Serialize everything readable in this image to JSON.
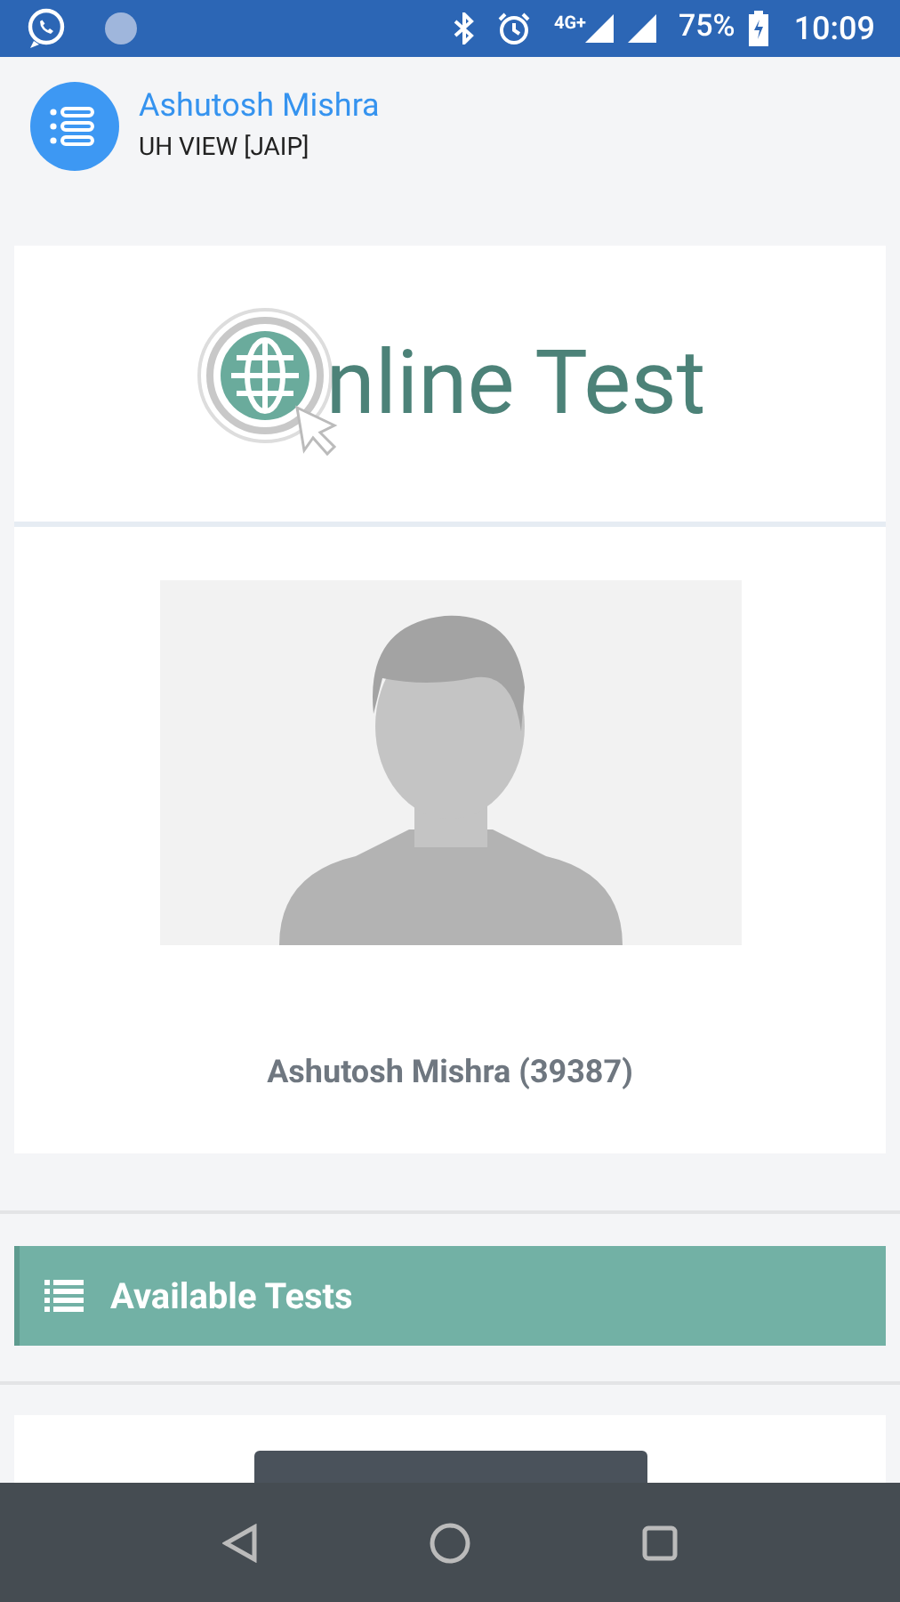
{
  "status_bar": {
    "battery": "75%",
    "time": "10:09",
    "network": "4G+"
  },
  "header": {
    "name": "Ashutosh Mishra",
    "subtitle": "UH VIEW [JAIP]"
  },
  "logo": {
    "text": "nline Test"
  },
  "profile": {
    "caption": "Ashutosh Mishra (39387)"
  },
  "section": {
    "title": "Available Tests"
  }
}
